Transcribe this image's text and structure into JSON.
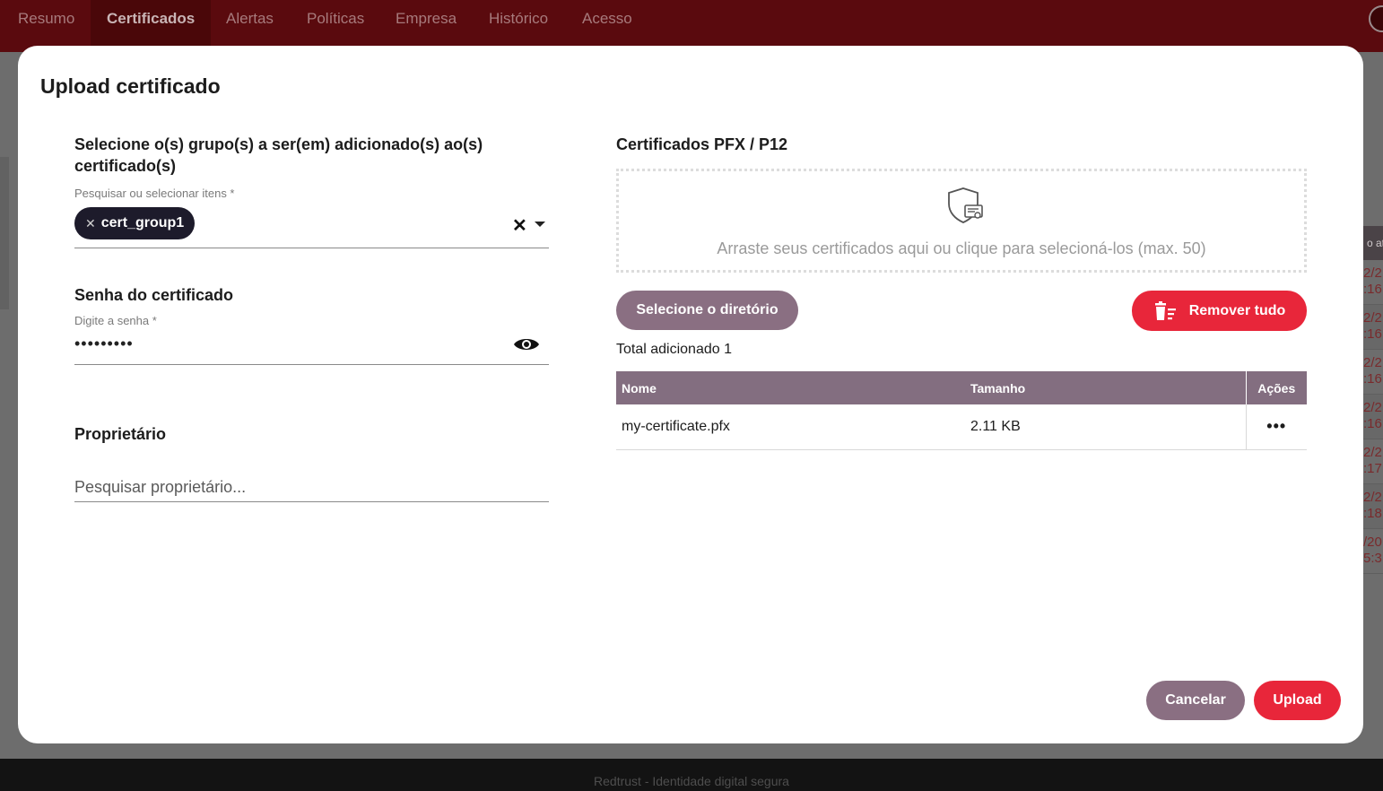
{
  "nav": {
    "tabs": [
      {
        "label": "Resumo"
      },
      {
        "label": "Certificados"
      },
      {
        "label": "Alertas"
      },
      {
        "label": "Políticas"
      },
      {
        "label": "Empresa"
      },
      {
        "label": "Histórico"
      },
      {
        "label": "Acesso"
      }
    ],
    "active_tab": "Certificados"
  },
  "background_table": {
    "header_fragment": "o at",
    "rows": [
      "2/2\n:16",
      "2/2\n:16",
      "2/2\n:16",
      "2/2\n:16",
      "2/2\n:17",
      "2/2\n:18",
      "/20\n5:3"
    ]
  },
  "modal": {
    "title": "Upload certificado",
    "groups": {
      "section_title": "Selecione o(s) grupo(s) a ser(em) adicionado(s) ao(s) certificado(s)",
      "field_label": "Pesquisar ou selecionar itens *",
      "selected_chips": [
        "cert_group1"
      ],
      "chip_remove_glyph": "✕",
      "clear_glyph": "✕"
    },
    "password": {
      "section_title": "Senha do certificado",
      "field_label": "Digite a senha *",
      "value_masked": "•••••••••"
    },
    "owner": {
      "section_title": "Proprietário",
      "placeholder": "Pesquisar proprietário..."
    },
    "certificates": {
      "section_title": "Certificados PFX / P12",
      "dropzone_text": "Arraste seus certificados aqui ou clique para selecioná-los (max. 50)",
      "select_dir_label": "Selecione o diretório",
      "remove_all_label": "Remover tudo",
      "total_label": "Total adicionado 1",
      "table": {
        "columns": [
          "Nome",
          "Tamanho",
          "Ações"
        ],
        "rows": [
          {
            "name": "my-certificate.pfx",
            "size": "2.11 KB",
            "actions": "•••"
          }
        ]
      }
    },
    "footer_buttons": {
      "cancel_label": "Cancelar",
      "upload_label": "Upload"
    }
  },
  "footer": {
    "text": "Redtrust - Identidade digital segura"
  },
  "colors": {
    "brand_red": "#e8263a",
    "mauve": "#8a6f82",
    "table_header": "#836e80",
    "chip_bg": "#1d1b2b"
  }
}
